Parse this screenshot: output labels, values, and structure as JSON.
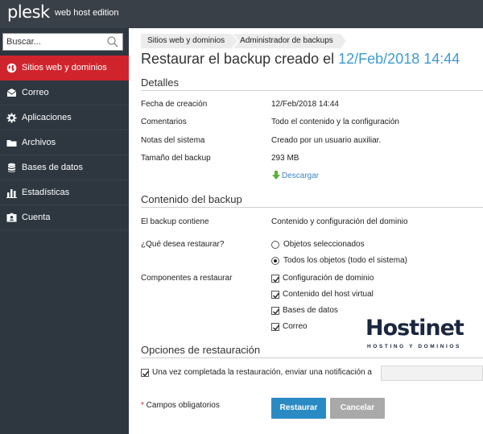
{
  "header": {
    "logo": "plesk",
    "edition": "web host edition"
  },
  "sidebar": {
    "search_placeholder": "Buscar...",
    "items": [
      {
        "label": "Sitios web y dominios",
        "icon": "globe-icon",
        "active": true
      },
      {
        "label": "Correo",
        "icon": "mail-icon",
        "active": false
      },
      {
        "label": "Aplicaciones",
        "icon": "gear-icon",
        "active": false
      },
      {
        "label": "Archivos",
        "icon": "folder-icon",
        "active": false
      },
      {
        "label": "Bases de datos",
        "icon": "database-icon",
        "active": false
      },
      {
        "label": "Estadísticas",
        "icon": "bar-chart-icon",
        "active": false
      },
      {
        "label": "Cuenta",
        "icon": "account-card-icon",
        "active": false
      }
    ]
  },
  "breadcrumb": [
    "Sitios web y dominios",
    "Administrador de backups"
  ],
  "title": {
    "prefix": "Restaurar el backup creado el ",
    "date": "12/Feb/2018 14:44"
  },
  "details": {
    "heading": "Detalles",
    "rows": [
      {
        "label": "Fecha de creación",
        "value": "12/Feb/2018 14:44"
      },
      {
        "label": "Comentarios",
        "value": "Todo el contenido y la configuración"
      },
      {
        "label": "Notas del sistema",
        "value": "Creado por un usuario auxiliar."
      },
      {
        "label": "Tamaño del backup",
        "value": "293 MB"
      }
    ],
    "download_label": "Descargar"
  },
  "contents": {
    "heading": "Contenido del backup",
    "contains_label": "El backup contiene",
    "contains_value": "Contenido y configuración del dominio",
    "restore_question": "¿Qué desea restaurar?",
    "radio_options": [
      {
        "label": "Objetos seleccionados",
        "selected": false
      },
      {
        "label": "Todos los objetos (todo el sistema)",
        "selected": true
      }
    ],
    "components_label": "Componentes a restaurar",
    "components": [
      {
        "label": "Configuración de dominio",
        "checked": true
      },
      {
        "label": "Contenido del host virtual",
        "checked": true
      },
      {
        "label": "Bases de datos",
        "checked": true
      },
      {
        "label": "Correo",
        "checked": true
      }
    ]
  },
  "restore_options": {
    "heading": "Opciones de restauración",
    "notify_label": "Una vez completada la restauración, enviar una notificación a",
    "notify_checked": true,
    "notify_email": ""
  },
  "footer": {
    "required_star": "*",
    "required_text": " Campos obligatorios",
    "restore_button": "Restaurar",
    "cancel_button": "Cancelar"
  },
  "watermark": {
    "title": "Hostinet",
    "subtitle": "HOSTING Y DOMINIOS"
  },
  "colors": {
    "topbar": "#3a4048",
    "sidebar": "#2e3740",
    "active_nav": "#d0242c",
    "accent_blue": "#3d9ad5",
    "primary_button": "#2a8bc4",
    "secondary_button": "#a9a9a9",
    "download_green": "#5bb33a"
  }
}
